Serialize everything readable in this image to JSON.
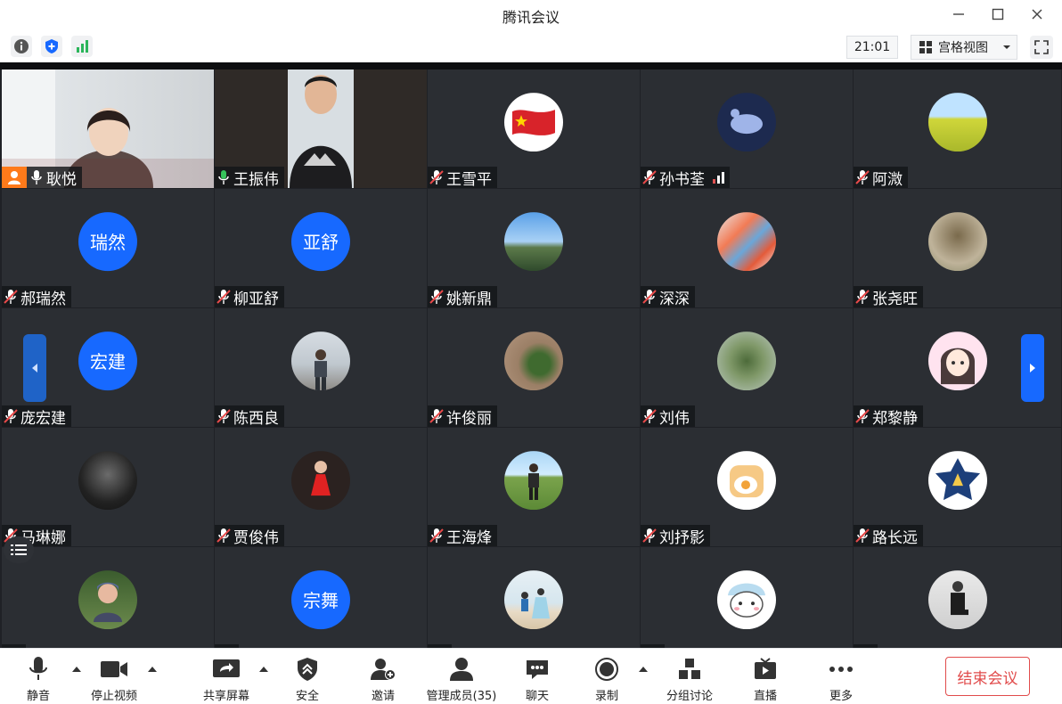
{
  "window": {
    "title": "腾讯会议"
  },
  "toolbar_top": {
    "time": "21:01",
    "view_label": "宫格视图"
  },
  "participants": [
    {
      "name": "耿悦",
      "muted": false,
      "type": "video-woman"
    },
    {
      "name": "王振伟",
      "muted": false,
      "type": "video-man",
      "speaking": true
    },
    {
      "name": "王雪平",
      "muted": true,
      "type": "flag"
    },
    {
      "name": "孙书荃",
      "muted": true,
      "type": "img-dark",
      "signal": true
    },
    {
      "name": "阿溦",
      "muted": true,
      "type": "img-field"
    },
    {
      "name": "郝瑞然",
      "muted": true,
      "type": "initials",
      "initials": "瑞然"
    },
    {
      "name": "柳亚舒",
      "muted": true,
      "type": "initials",
      "initials": "亚舒"
    },
    {
      "name": "姚新鼎",
      "muted": true,
      "type": "img-sky"
    },
    {
      "name": "深深",
      "muted": true,
      "type": "img-cake"
    },
    {
      "name": "张尧旺",
      "muted": true,
      "type": "img-tree"
    },
    {
      "name": "庞宏建",
      "muted": true,
      "type": "initials",
      "initials": "宏建"
    },
    {
      "name": "陈西良",
      "muted": true,
      "type": "img-person"
    },
    {
      "name": "许俊丽",
      "muted": true,
      "type": "img-leaf"
    },
    {
      "name": "刘伟",
      "muted": true,
      "type": "img-green"
    },
    {
      "name": "郑黎静",
      "muted": true,
      "type": "img-anime"
    },
    {
      "name": "马琳娜",
      "muted": true,
      "type": "img-bw"
    },
    {
      "name": "贾俊伟",
      "muted": true,
      "type": "img-girl"
    },
    {
      "name": "王海烽",
      "muted": true,
      "type": "img-grass"
    },
    {
      "name": "刘抒影",
      "muted": true,
      "type": "img-egg"
    },
    {
      "name": "路长远",
      "muted": true,
      "type": "img-star"
    },
    {
      "name": "",
      "muted": true,
      "type": "img-woman2"
    },
    {
      "name": "",
      "muted": true,
      "type": "initials",
      "initials": "宗舞"
    },
    {
      "name": "",
      "muted": true,
      "type": "img-beach"
    },
    {
      "name": "",
      "muted": true,
      "type": "img-cartoon"
    },
    {
      "name": "",
      "muted": true,
      "type": "img-sit"
    }
  ],
  "bottom": {
    "mute": "静音",
    "stop_video": "停止视频",
    "share": "共享屏幕",
    "security": "安全",
    "invite": "邀请",
    "members": "管理成员(35)",
    "chat": "聊天",
    "record": "录制",
    "breakout": "分组讨论",
    "live": "直播",
    "more": "更多",
    "end": "结束会议"
  },
  "colors": {
    "accent": "#1769ff",
    "end": "#e14b4b",
    "speaking": "#37c35b"
  }
}
